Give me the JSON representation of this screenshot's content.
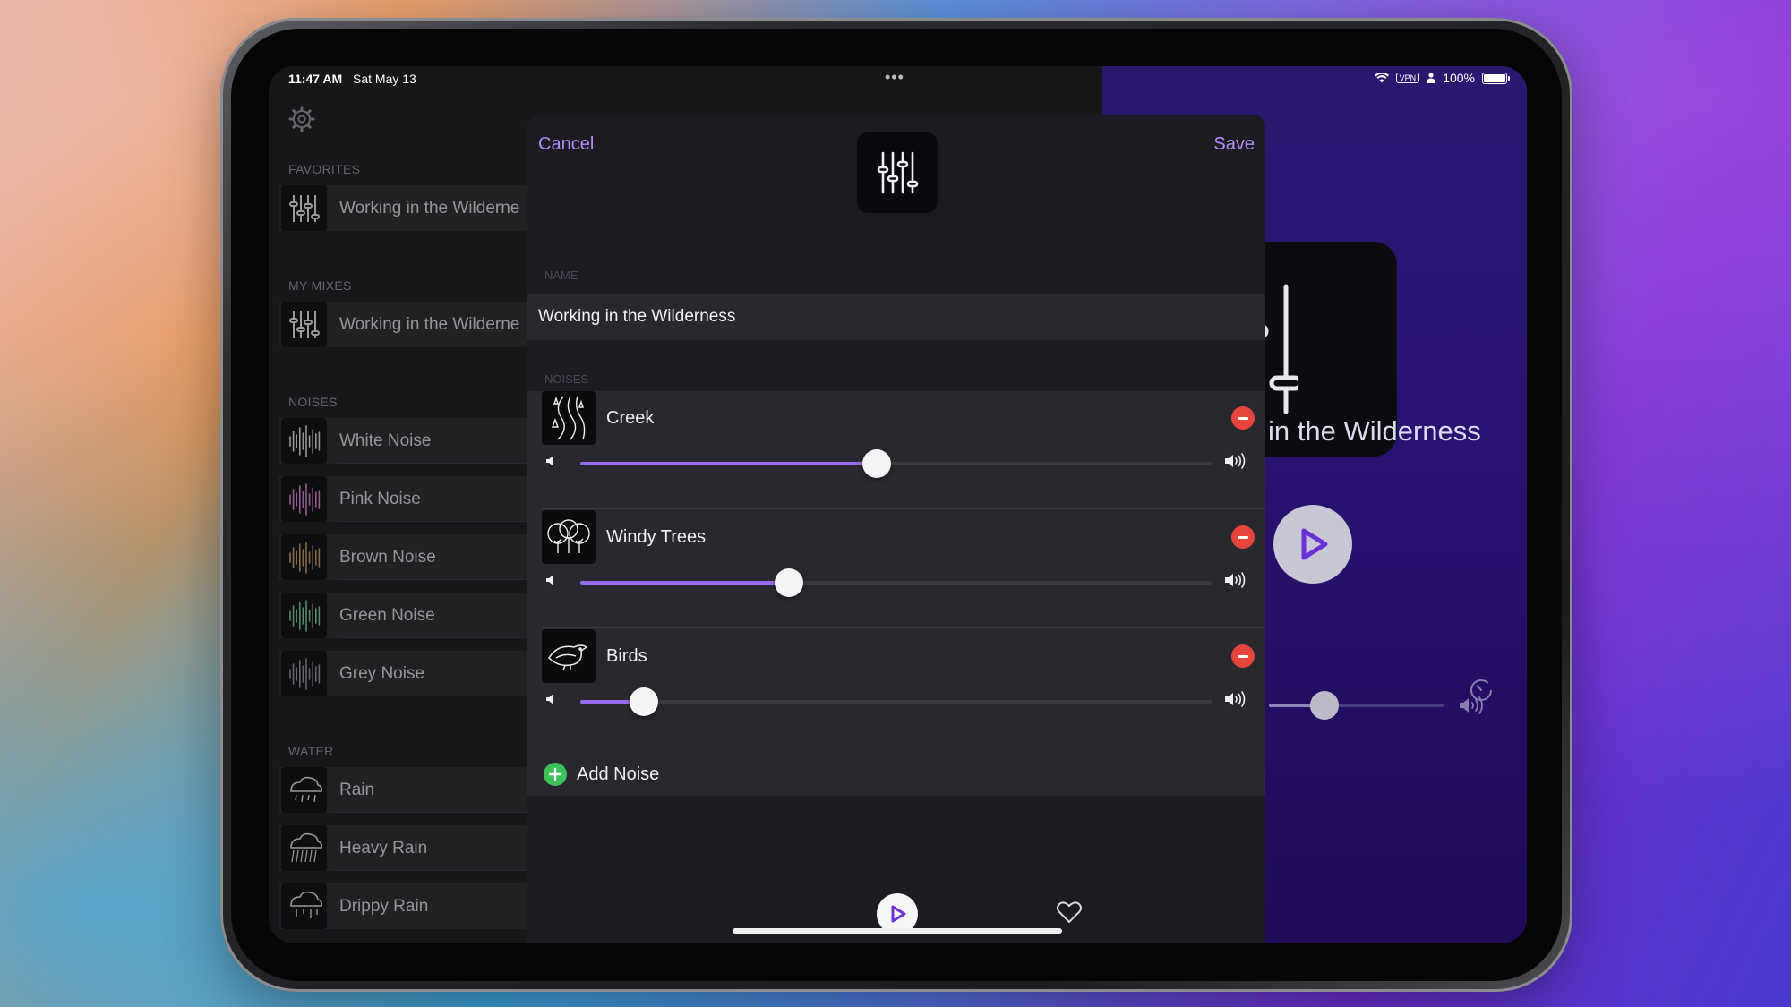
{
  "status_bar": {
    "time": "11:47 AM",
    "date": "Sat May 13",
    "vpn": "VPN",
    "battery": "100%"
  },
  "sidebar": {
    "sections": [
      {
        "header": "FAVORITES",
        "items": [
          {
            "label": "Working in the Wilderne",
            "icon": "mixer-icon"
          }
        ]
      },
      {
        "header": "MY MIXES",
        "items": [
          {
            "label": "Working in the Wilderne",
            "icon": "mixer-icon"
          }
        ]
      },
      {
        "header": "NOISES",
        "items": [
          {
            "label": "White Noise",
            "icon": "waveform-icon",
            "color": "#e8e8ea"
          },
          {
            "label": "Pink Noise",
            "icon": "waveform-icon",
            "color": "#e08ad6"
          },
          {
            "label": "Brown Noise",
            "icon": "waveform-icon",
            "color": "#c9a36a"
          },
          {
            "label": "Green Noise",
            "icon": "waveform-icon",
            "color": "#7fd19a"
          },
          {
            "label": "Grey Noise",
            "icon": "waveform-icon",
            "color": "#9a9aa0"
          }
        ]
      },
      {
        "header": "WATER",
        "items": [
          {
            "label": "Rain",
            "icon": "rain-cloud-icon"
          },
          {
            "label": "Heavy Rain",
            "icon": "heavy-rain-cloud-icon"
          },
          {
            "label": "Drippy Rain",
            "icon": "drippy-rain-cloud-icon"
          }
        ]
      }
    ]
  },
  "now_playing": {
    "title_fragment": "in the Wilderness",
    "volume_fraction": 0.32
  },
  "modal": {
    "cancel_label": "Cancel",
    "save_label": "Save",
    "name_label": "NAME",
    "name_value": "Working in the Wilderness",
    "noises_label": "NOISES",
    "noises": [
      {
        "name": "Creek",
        "icon": "creek-icon",
        "volume": 0.47
      },
      {
        "name": "Windy Trees",
        "icon": "trees-icon",
        "volume": 0.33
      },
      {
        "name": "Birds",
        "icon": "bird-icon",
        "volume": 0.1
      }
    ],
    "add_noise_label": "Add Noise"
  },
  "colors": {
    "accent": "#b18cff",
    "slider_fill": "#9a6cf0",
    "remove": "#e5453a",
    "add": "#3cc25a"
  }
}
